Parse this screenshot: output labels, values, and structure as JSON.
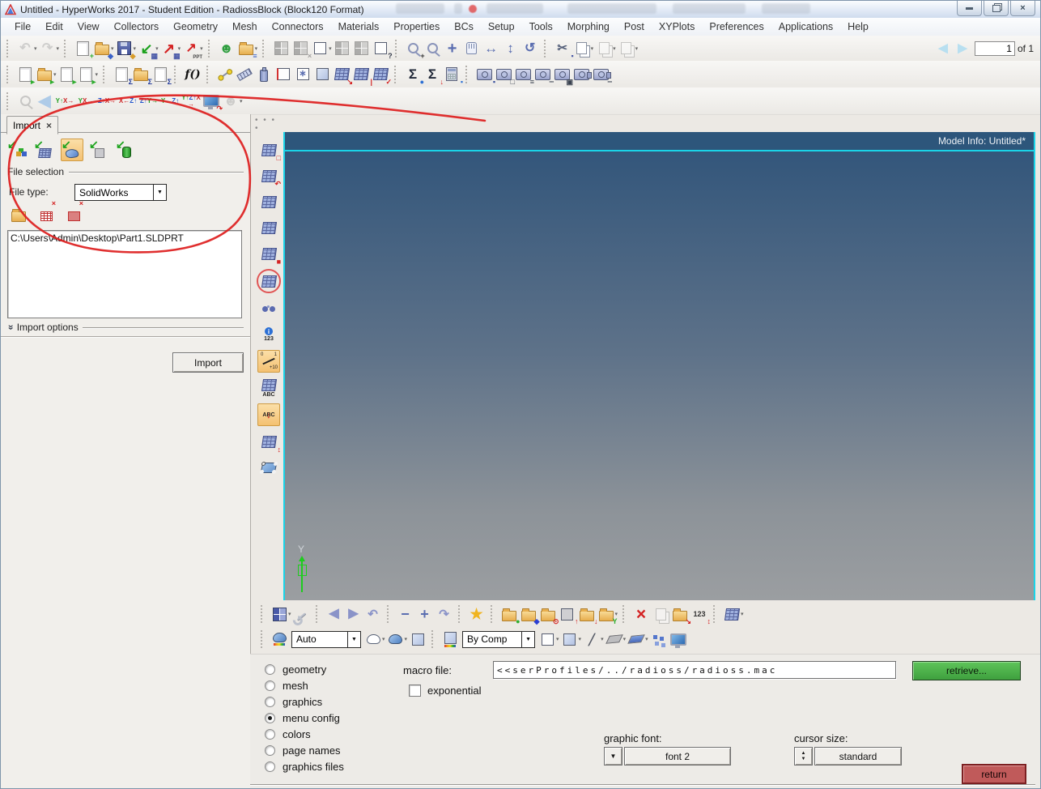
{
  "window": {
    "title": "Untitled - HyperWorks 2017 - Student Edition - RadiossBlock (Block120 Format)"
  },
  "menu": [
    "File",
    "Edit",
    "View",
    "Collectors",
    "Geometry",
    "Mesh",
    "Connectors",
    "Materials",
    "Properties",
    "BCs",
    "Setup",
    "Tools",
    "Morphing",
    "Post",
    "XYPlots",
    "Preferences",
    "Applications",
    "Help"
  ],
  "page_nav": {
    "current": "1",
    "of": "of 1",
    "back": [
      {
        "n": "page-back-button",
        "g": "◀",
        "c": "#b8dff0",
        "fs": 15
      },
      {
        "n": "page-forward-button",
        "g": "▶",
        "c": "#b8dff0",
        "fs": 15
      }
    ]
  },
  "toolbars": {
    "row1": [
      {
        "sep": 1
      },
      {
        "n": "undo-button",
        "g": "↶",
        "c": "#9aa4b8",
        "fs": 16,
        "gray": 1,
        "dd": 1
      },
      {
        "n": "redo-button",
        "g": "↷",
        "c": "#9aa4b8",
        "fs": 16,
        "gray": 1,
        "dd": 1
      },
      {
        "sep": 1
      },
      {
        "n": "new-session-button",
        "t": "doc",
        "b": "+",
        "bc": "#2fae2f"
      },
      {
        "n": "open-model-button",
        "t": "folder",
        "b": "◆",
        "bc": "#3a62c8",
        "dd": 1
      },
      {
        "n": "save-model-button",
        "t": "disk",
        "b": "◆",
        "bc": "#d89c2a",
        "dd": 1
      },
      {
        "n": "import-solver-deck-button",
        "g": "↙",
        "c": "#19a019",
        "fs": 18,
        "b": "▦",
        "bc": "#4a5aa8",
        "dd": 1
      },
      {
        "n": "export-solver-deck-button",
        "g": "↗",
        "c": "#d42222",
        "fs": 18,
        "b": "▦",
        "bc": "#4a5aa8",
        "dd": 1
      },
      {
        "n": "export-ppt-button",
        "g": "↗",
        "c": "#d42222",
        "fs": 16,
        "b": "PPT",
        "bc": "#444",
        "dd": 1
      },
      {
        "sep": 1
      },
      {
        "n": "user-profiles-button",
        "g": "☻",
        "c": "#2f9e3f",
        "fs": 17
      },
      {
        "n": "organize-library-button",
        "t": "folder",
        "b": "≡",
        "bc": "#3a62c8",
        "dd": 1
      },
      {
        "sep": 1
      },
      {
        "n": "add-page-button",
        "t": "pane",
        "gray": 1
      },
      {
        "n": "delete-page-button",
        "t": "pane",
        "gray": 1,
        "b": "×",
        "bc": "#d42222"
      },
      {
        "n": "expand-page-button",
        "t": "cubew",
        "dd": 1
      },
      {
        "n": "arrange-pages-button",
        "t": "pane",
        "gray": 1
      },
      {
        "n": "split-page-button",
        "t": "pane",
        "gray": 1
      },
      {
        "n": "keyboard-map-button",
        "t": "cubew",
        "b": "?",
        "bc": "#333a4a"
      },
      {
        "sep": 1
      },
      {
        "n": "zoom-in-button",
        "t": "mag",
        "b": "+",
        "bc": "#333"
      },
      {
        "n": "circle-zoom-button",
        "t": "mag"
      },
      {
        "n": "fit-view-button",
        "g": "+",
        "c": "#5a6db0",
        "fs": 20
      },
      {
        "n": "pan-button",
        "t": "hand"
      },
      {
        "n": "rotate-horizontal-button",
        "g": "↔",
        "c": "#5a6db0",
        "fs": 17
      },
      {
        "n": "rotate-vertical-button",
        "g": "↕",
        "c": "#5a6db0",
        "fs": 17
      },
      {
        "n": "dynamic-rotate-button",
        "g": "↺",
        "c": "#5a6db0",
        "fs": 16
      },
      {
        "sep": 1
      },
      {
        "n": "cut-button",
        "g": "✂",
        "c": "#55607a",
        "fs": 15,
        "b": "▪",
        "bc": "#4a5aa8"
      },
      {
        "n": "copy-button",
        "t": "docs",
        "dd": 1
      },
      {
        "n": "paste-button",
        "t": "docs",
        "gray": 1,
        "dd": 1
      },
      {
        "n": "paste-special-button",
        "t": "docs",
        "gray": 1,
        "dd": 1
      }
    ],
    "row2": [
      {
        "sep": 1
      },
      {
        "n": "new-report-button",
        "t": "doc",
        "b": "►",
        "bc": "#2fae2f"
      },
      {
        "n": "open-report-button",
        "t": "folder",
        "b": "►",
        "bc": "#2fae2f",
        "dd": 1
      },
      {
        "n": "run-report-button",
        "t": "doc",
        "b": "►",
        "bc": "#2fae2f"
      },
      {
        "n": "export-report-button",
        "t": "doc",
        "b": "►",
        "bc": "#2fae2f",
        "dd": 1
      },
      {
        "sep": 1
      },
      {
        "n": "new-template-button",
        "t": "doc",
        "b": "Σ",
        "bc": "#223a9a"
      },
      {
        "n": "open-template-button",
        "t": "folder",
        "b": "Σ",
        "bc": "#223a9a"
      },
      {
        "n": "run-template-button",
        "t": "doc",
        "b": "Σ",
        "bc": "#223a9a"
      },
      {
        "sep": 1
      },
      {
        "n": "expression-builder-button",
        "g": "f()",
        "c": "#111",
        "fs": 14,
        "serif": 1
      },
      {
        "sep": 1
      },
      {
        "n": "measure-distance-button",
        "t": "dist"
      },
      {
        "n": "ruler-button",
        "t": "ruler"
      },
      {
        "n": "mass-properties-button",
        "t": "bottle"
      },
      {
        "n": "visual-wire-cube-button",
        "t": "cubew",
        "extra": "redge"
      },
      {
        "n": "visual-axes-cube-button",
        "t": "cubew",
        "g": "∗",
        "c": "#5a6db0",
        "fs": 11
      },
      {
        "n": "visual-solid-cube-button",
        "t": "cube"
      },
      {
        "n": "import-mesh-button",
        "t": "mesh",
        "b": "↘",
        "bc": "#d42222"
      },
      {
        "n": "section-cut-button",
        "t": "mesh",
        "b": "|",
        "bc": "#d42222"
      },
      {
        "n": "verify-mesh-button",
        "t": "mesh",
        "b": "✓",
        "bc": "#d42222"
      },
      {
        "sep": 1
      },
      {
        "n": "summation-button",
        "g": "Σ",
        "c": "#202838",
        "fs": 17,
        "b": "●",
        "bc": "#2b6fd4"
      },
      {
        "n": "sorted-summation-button",
        "g": "Σ",
        "c": "#202838",
        "fs": 17,
        "b": "↓",
        "bc": "#d42222"
      },
      {
        "n": "quick-calculator-button",
        "t": "calc",
        "b": "▪",
        "bc": "#2b6fd4"
      },
      {
        "sep": 1
      },
      {
        "n": "capture-save-button",
        "t": "cam",
        "b": "▪",
        "bc": "#334a9a"
      },
      {
        "n": "capture-window-button",
        "t": "cam",
        "b": "□",
        "bc": "#3a4250"
      },
      {
        "n": "capture-toolbar-button",
        "t": "cam",
        "b": "≡",
        "bc": "#3a4250"
      },
      {
        "n": "capture-region-button",
        "t": "cam",
        "b": "┄",
        "bc": "#3a4250"
      },
      {
        "n": "capture-area-button",
        "t": "cam",
        "b": "▣",
        "bc": "#3a4250"
      },
      {
        "n": "record-video-button",
        "t": "cam",
        "extra": "video"
      },
      {
        "n": "record-region-button",
        "t": "cam",
        "extra": "video",
        "b": "┄",
        "bc": "#3a4250"
      }
    ],
    "row3": [
      {
        "sep": 1
      },
      {
        "n": "spin-zoom-button",
        "t": "mag",
        "gray": 1
      },
      {
        "n": "view-back-button",
        "g": "◀",
        "c": "#aecbe8",
        "fs": 20
      },
      {
        "n": "view-xy-plane-button",
        "t": "ax",
        "g": "Y↑X→"
      },
      {
        "n": "view-front-button",
        "t": "ax",
        "g": "Y.X→"
      },
      {
        "n": "view-zx-plane-button",
        "t": "ax",
        "g": "Z↑X→"
      },
      {
        "n": "view-xz-plane-button",
        "t": "ax",
        "g": "X←Z↑"
      },
      {
        "n": "view-zy-plane-button",
        "t": "ax",
        "g": "Z↑Y→"
      },
      {
        "n": "view-yz-plane-button",
        "t": "ax",
        "g": "Y←Z↑"
      },
      {
        "n": "view-iso-button",
        "t": "ax",
        "g": "Y↑Z↑X→"
      },
      {
        "n": "presentation-button",
        "t": "screen",
        "b": "↷",
        "bc": "#d42222"
      },
      {
        "n": "user-view-button",
        "g": "☻",
        "c": "#9aa4b0",
        "fs": 17,
        "gray": 1,
        "dd": 1
      }
    ],
    "strip": [
      {
        "n": "check-elements-icon",
        "t": "mesh",
        "b": "□",
        "bc": "#d42222"
      },
      {
        "n": "element-normals-icon",
        "t": "mesh",
        "b": "↶",
        "bc": "#d42222"
      },
      {
        "n": "features-icon",
        "t": "mesh"
      },
      {
        "n": "faces-icon",
        "t": "mesh"
      },
      {
        "n": "free-edges-icon",
        "t": "mesh",
        "b": "■",
        "bc": "#d42222"
      },
      {
        "n": "penetration-check-icon",
        "t": "mesh",
        "extra": "circ"
      },
      {
        "n": "find-entities-icon",
        "t": "bino"
      },
      {
        "n": "count-entities-icon",
        "t": "i123",
        "g": "i",
        "lbl": "123"
      },
      {
        "n": "numbers-panel-icon",
        "t": "gauge",
        "x1": "0",
        "x2": "1",
        "x3": "+10",
        "box": 1
      },
      {
        "n": "labels-icon",
        "t": "mesh",
        "lbl": "ABC"
      },
      {
        "n": "sort-labels-icon",
        "t": "abc",
        "g": "↓",
        "c": "#d42222",
        "fs": 12,
        "lbl": "ABC",
        "box": 1
      },
      {
        "n": "element-order-icon",
        "t": "mesh",
        "b": "↕",
        "bc": "#d42222"
      },
      {
        "n": "surface-edit-icon",
        "t": "surf"
      }
    ],
    "brow1": [
      {
        "sep": 1
      },
      {
        "n": "panels-button",
        "t": "pane",
        "dd": 1
      },
      {
        "n": "options-button",
        "t": "wrench"
      },
      {
        "sep": 1
      },
      {
        "n": "previous-panel-button",
        "g": "◀",
        "c": "#8a93c8",
        "fs": 16
      },
      {
        "n": "next-panel-button",
        "g": "▶",
        "c": "#8a93c8",
        "fs": 16
      },
      {
        "n": "undo-view-button",
        "g": "↶",
        "c": "#8a93c8",
        "fs": 15
      },
      {
        "sep": 1
      },
      {
        "n": "zoom-out-button",
        "g": "−",
        "c": "#5a6db0",
        "fs": 18
      },
      {
        "n": "zoom-in-2-button",
        "g": "+",
        "c": "#5a6db0",
        "fs": 18
      },
      {
        "n": "redo-view-button",
        "g": "↷",
        "c": "#8a93c8",
        "fs": 15
      },
      {
        "sep": 1
      },
      {
        "n": "favorites-button",
        "g": "★",
        "c": "#f0b41e",
        "fs": 18
      },
      {
        "sep": 1
      },
      {
        "n": "component-collector-button",
        "t": "folder",
        "b": "●",
        "bc": "#2fae2f"
      },
      {
        "n": "material-collector-button",
        "t": "folder",
        "b": "◆",
        "bc": "#2b3fd4"
      },
      {
        "n": "property-collector-button",
        "t": "folder",
        "b": "⊙",
        "bc": "#d42222"
      },
      {
        "n": "system-collector-button",
        "t": "cube",
        "extra": "graycube",
        "b": "↑",
        "bc": "#d42222"
      },
      {
        "n": "load-collector-button",
        "t": "folder",
        "b": "↓",
        "bc": "#d42222"
      },
      {
        "n": "curve-collector-button",
        "t": "folder",
        "b": "Y",
        "bc": "#2fae2f",
        "dd": 1
      },
      {
        "sep": 1
      },
      {
        "n": "delete-button",
        "g": "×",
        "c": "#d42222",
        "fs": 21
      },
      {
        "n": "mask-button",
        "t": "docs",
        "gray": 1
      },
      {
        "n": "organize-button",
        "t": "folder",
        "b": "↘",
        "bc": "#d42222"
      },
      {
        "n": "renumber-button",
        "g": "123",
        "c": "#333",
        "fs": 9,
        "b": "↕",
        "bc": "#d42222"
      },
      {
        "sep": 1
      },
      {
        "n": "mesh-panel-button",
        "t": "mesh",
        "dd": 1
      }
    ],
    "brow2": [
      {
        "sep": 1
      },
      {
        "n": "geometry-shade-mode-icon",
        "t": "shade",
        "rb": 1
      },
      {
        "select": "Auto",
        "n": "geometry-shade-select",
        "w": 84
      },
      {
        "n": "wireframe-geometry-button",
        "t": "shadew",
        "dd": 1
      },
      {
        "n": "shaded-geometry-button",
        "t": "shade",
        "dd": 1
      },
      {
        "n": "solid-geometry-button",
        "t": "cube"
      },
      {
        "sep": 1
      },
      {
        "n": "element-color-mode-icon",
        "t": "cube",
        "rb": 1
      },
      {
        "select": "By Comp",
        "n": "element-color-select",
        "w": 88
      },
      {
        "n": "wireframe-elements-button",
        "t": "cubew",
        "dd": 1
      },
      {
        "n": "shaded-elements-button",
        "t": "cube",
        "dd": 1
      },
      {
        "n": "1d-elements-button",
        "g": "╱",
        "c": "#555a66",
        "fs": 13,
        "dd": 1
      },
      {
        "n": "2d-elements-button",
        "t": "flat",
        "dd": 1
      },
      {
        "n": "3d-elements-button",
        "t": "flat",
        "extra": "blue",
        "dd": 1
      },
      {
        "n": "multi-model-button",
        "t": "multi"
      },
      {
        "n": "performance-graphics-button",
        "t": "screen"
      }
    ]
  },
  "panel": {
    "tab": "Import",
    "tab_close": "×",
    "icons": [
      {
        "n": "import-model-button",
        "t": "imp",
        "base": "blocks"
      },
      {
        "n": "import-solverdeck-button",
        "t": "imp",
        "base": "mesh"
      },
      {
        "n": "import-geometry-button",
        "t": "imp",
        "base": "geo",
        "box": 1
      },
      {
        "n": "import-connectors-button",
        "t": "imp",
        "base": "cube"
      },
      {
        "n": "import-bom-button",
        "t": "imp",
        "base": "cyl"
      }
    ],
    "file_selection": "File selection",
    "file_type_label": "File type:",
    "file_type_value": "SolidWorks",
    "file_icons": [
      {
        "n": "select-file-button",
        "t": "folder",
        "big": 1
      },
      {
        "n": "remove-file-button",
        "t": "tablex",
        "b": "×",
        "bc": "#d42222"
      },
      {
        "n": "remove-all-files-button",
        "t": "tablex",
        "extra": "fill",
        "b": "×",
        "bc": "#d42222"
      }
    ],
    "file_path": "C:\\Users\\Admin\\Desktop\\Part1.SLDPRT",
    "options_chevron": "«",
    "import_options": "Import options",
    "import_button": "Import"
  },
  "viewport": {
    "model_info": "Model Info: Untitled*",
    "axis": "Y"
  },
  "settings": {
    "radios": [
      "geometry",
      "mesh",
      "graphics",
      "menu config",
      "colors",
      "page names",
      "graphics files"
    ],
    "selected_radio": 3,
    "macro_file_label": "macro file:",
    "macro_file_value": "<<serProfiles/../radioss/radioss.mac",
    "exponential_label": "exponential",
    "retrieve_label": "retrieve...",
    "graphic_font_label": "graphic font:",
    "graphic_font_value": "font 2",
    "cursor_size_label": "cursor size:",
    "cursor_size_value": "standard",
    "return_label": "return"
  }
}
